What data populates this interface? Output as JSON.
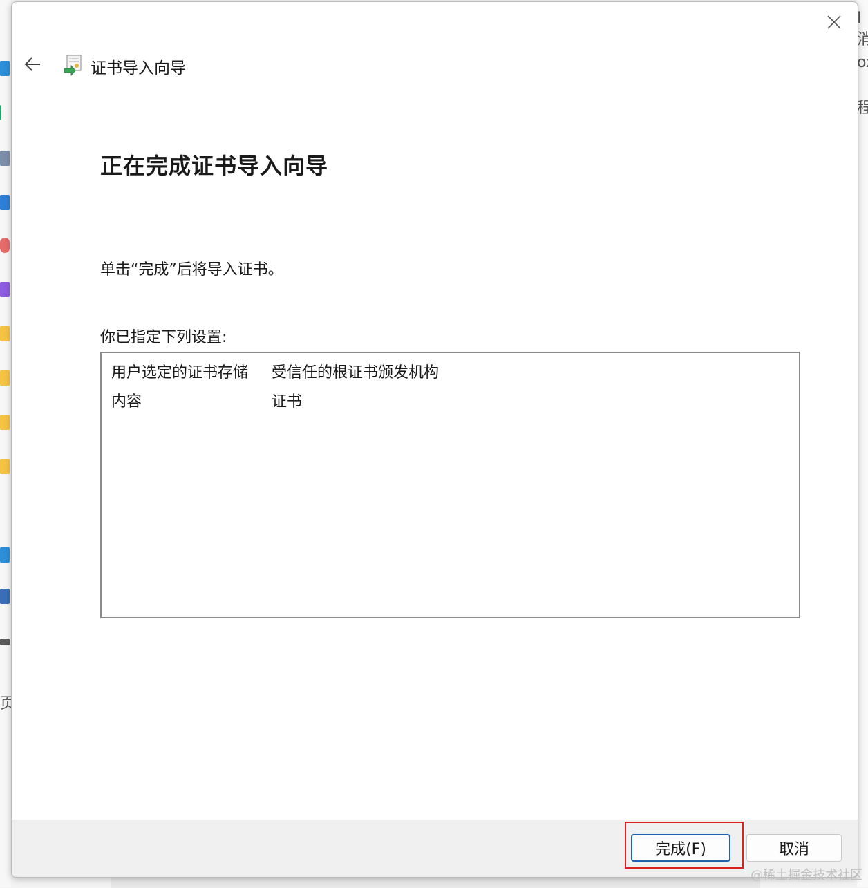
{
  "dialog": {
    "title": "证书导入向导",
    "heading": "正在完成证书导入向导",
    "description": "单击“完成”后将导入证书。",
    "settings_label": "你已指定下列设置:",
    "settings": [
      {
        "key": "用户选定的证书存储",
        "value": "受信任的根证书颁发机构"
      },
      {
        "key": "内容",
        "value": "证书"
      }
    ],
    "buttons": {
      "finish": "完成(F)",
      "cancel": "取消"
    }
  },
  "background": {
    "right_chars": [
      "I 消",
      "ox",
      "程"
    ],
    "left_chars": [
      "页"
    ]
  },
  "watermark": "@稀土掘金技术社区",
  "colors": {
    "accent": "#1f5fb4",
    "highlight": "#e02020"
  }
}
